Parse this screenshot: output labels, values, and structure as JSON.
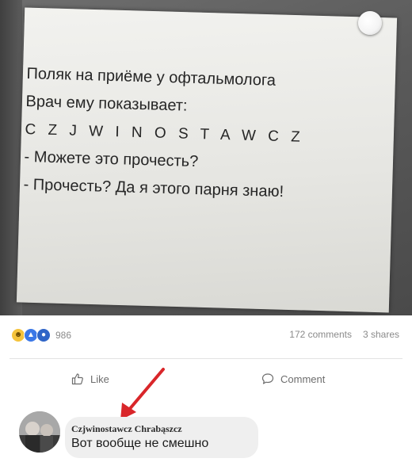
{
  "post_image": {
    "lines": [
      "Поляк на приёме у офтальмолога",
      "Врач ему показывает:",
      "C Z J W I N O S T A W C Z",
      "- Можете это прочесть?",
      "- Прочесть? Да я этого парня знаю!"
    ]
  },
  "stats": {
    "reaction_icons": [
      "haha-reaction-icon",
      "like-reaction-icon",
      "love-reaction-icon"
    ],
    "reaction_count": "986",
    "comments": "172 comments",
    "shares": "3 shares"
  },
  "actions": {
    "like_label": "Like",
    "comment_label": "Comment"
  },
  "comment": {
    "author": "Czjwinostawcz Chrabąszcz",
    "text": "Вот вообще не смешно"
  },
  "colors": {
    "arrow": "#d9262a",
    "reaction_haha": "#f5c33b",
    "reaction_like": "#3b78e7",
    "bubble": "#efefef"
  }
}
